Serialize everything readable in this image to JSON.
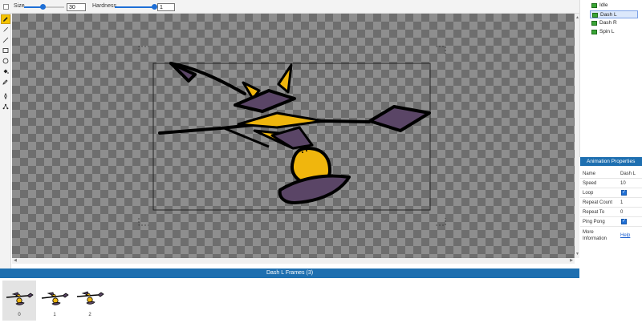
{
  "toolbar": {
    "size_label": "Size",
    "size_value": "30",
    "hardness_label": "Hardness",
    "hardness_value": "1"
  },
  "tools": [
    "pencil-icon",
    "brush-icon",
    "line-icon",
    "rectangle-icon",
    "ellipse-icon",
    "fill-bucket-icon",
    "eyedropper-icon",
    "move-point-icon",
    "node-icon"
  ],
  "animations": {
    "items": [
      {
        "label": "Idle"
      },
      {
        "label": "Dash L",
        "selected": true
      },
      {
        "label": "Dash R"
      },
      {
        "label": "Spin L"
      }
    ]
  },
  "frames": {
    "header": "Dash L Frames (3)",
    "items": [
      {
        "num": "0",
        "selected": true
      },
      {
        "num": "1"
      },
      {
        "num": "2"
      }
    ]
  },
  "properties": {
    "header": "Animation Properties",
    "name_label": "Name",
    "name_value": "Dash L",
    "speed_label": "Speed",
    "speed_value": "10",
    "loop_label": "Loop",
    "repeat_count_label": "Repeat Count",
    "repeat_count_value": "1",
    "repeat_to_label": "Repeat To",
    "repeat_to_value": "0",
    "ping_pong_label": "Ping Pong",
    "more_info_label": "More Information",
    "help_link": "Help"
  },
  "colors": {
    "accent": "#1e6fb0",
    "slider": "#1e6fd6",
    "sprite_yellow": "#f0b60d",
    "sprite_purple": "#5a4566"
  }
}
